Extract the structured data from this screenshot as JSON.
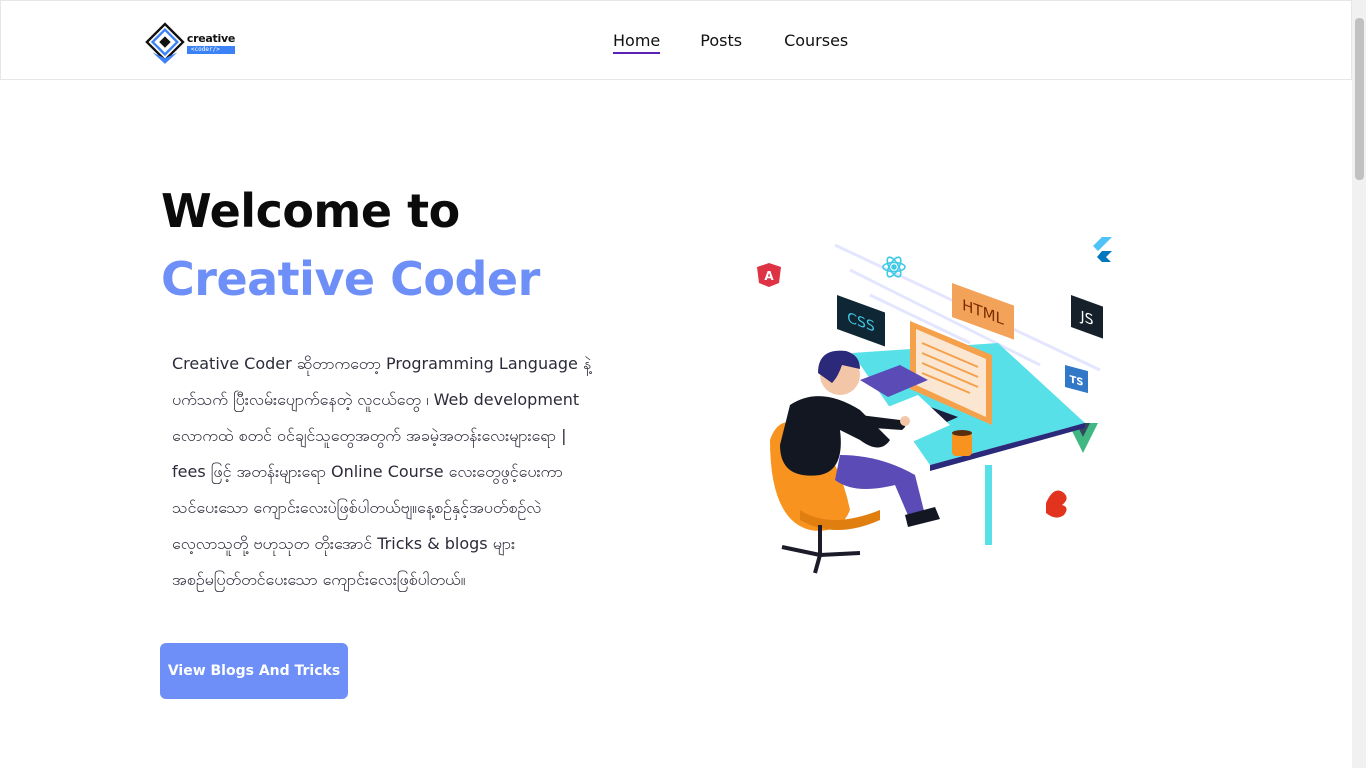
{
  "header": {
    "logo": {
      "word": "creative",
      "sub": "<coder/>"
    },
    "nav": [
      {
        "label": "Home",
        "active": true
      },
      {
        "label": "Posts"
      },
      {
        "label": "Courses"
      }
    ]
  },
  "hero": {
    "title_line1": "Welcome to",
    "title_line2": "Creative Coder",
    "description_lines": [
      "Creative Coder ဆိုတာကတော့ Programming Language နဲ့",
      "ပက်သက် ပြီးလမ်းပျောက်နေတဲ့ လူငယ်တွေ ၊ Web development",
      "လောကထဲ စတင် ဝင်ချင်သူတွေအတွက် အခမဲ့အတန်းလေးများရော |",
      "fees ဖြင့် အတန်းများရော Online Course လေးတွေဖွင့်ပေးကာ",
      "သင်ပေးသော ကျောင်းလေးပဲဖြစ်ပါတယ်ဗျ။နေ့စဉ်နှင့်အပတ်စဉ်လဲ",
      "လေ့လာသူတို့ ဗဟုသုတ တိုးအောင် Tricks & blogs များ",
      "အစဉ်မပြတ်တင်ပေးသော ကျောင်းလေးဖြစ်ပါတယ်။"
    ],
    "cta_label": "View Blogs And Tricks"
  },
  "illustration": {
    "badges": [
      "CSS",
      "HTML",
      "JS",
      "TS"
    ],
    "angular_letter": "A",
    "colors": {
      "accent": "#6d8ff7",
      "desk": "#57e0e8",
      "chair": "#f7931e",
      "pants": "#5b4bb7",
      "nav_underline": "#5b21b6"
    }
  }
}
